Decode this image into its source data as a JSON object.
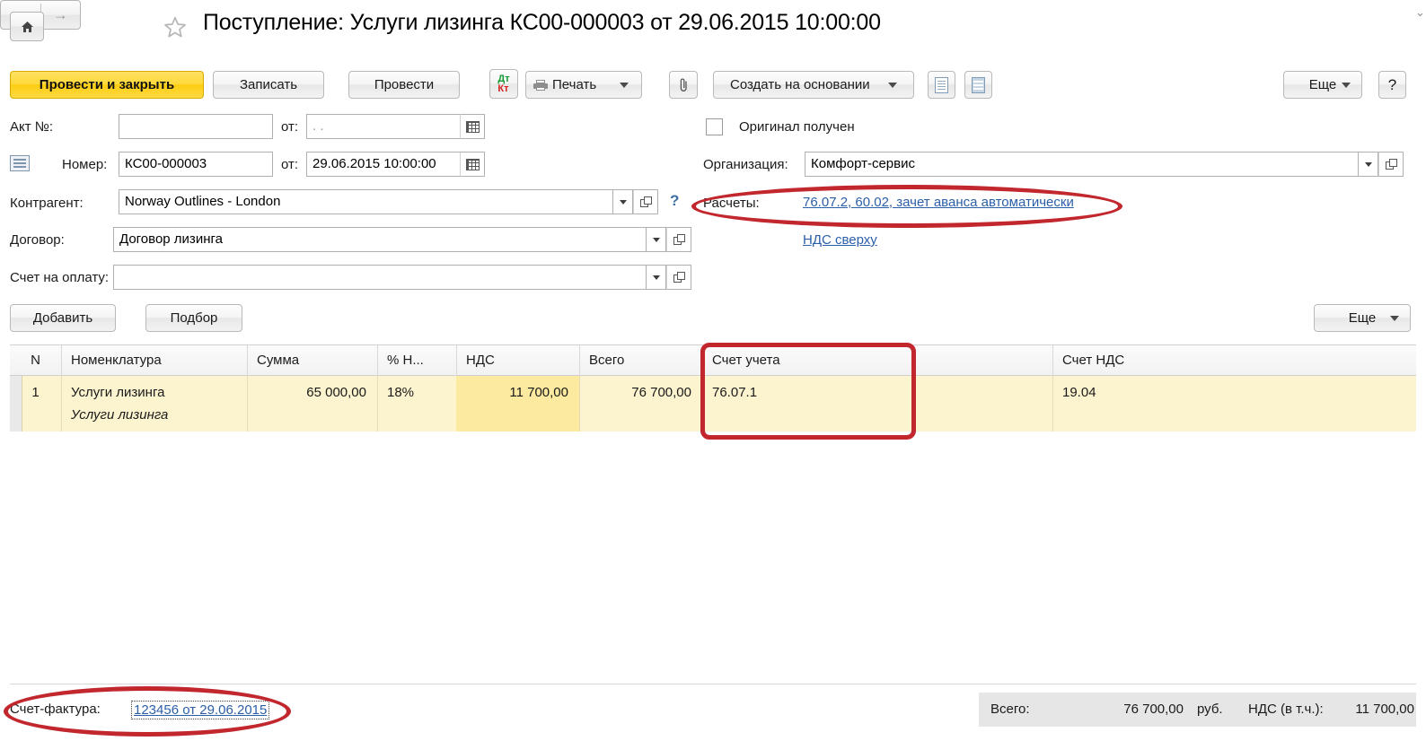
{
  "window": {
    "title": "Поступление: Услуги лизинга КС00-000003 от 29.06.2015 10:00:00"
  },
  "nav": {
    "home_icon": "home-icon",
    "back_icon": "arrow-left-icon",
    "forward_icon": "arrow-right-icon",
    "favorite_icon": "star-icon"
  },
  "toolbar": {
    "post_and_close": "Провести и закрыть",
    "write": "Записать",
    "post": "Провести",
    "dt_label": "Дт",
    "kt_label": "Кт",
    "print": "Печать",
    "attach_icon": "paperclip-icon",
    "create_based_on": "Создать на основании",
    "doc_icon": "document-icon",
    "register_icon": "register-list-icon",
    "more": "Еще",
    "help": "?"
  },
  "form": {
    "act_number_label": "Акт №:",
    "act_number_value": "",
    "act_from_label": "от:",
    "act_from_value": ". .",
    "number_label": "Номер:",
    "number_value": "КС00-000003",
    "number_from_label": "от:",
    "number_from_value": "29.06.2015 10:00:00",
    "counterparty_label": "Контрагент:",
    "counterparty_value": "Norway Outlines - London",
    "contract_label": "Договор:",
    "contract_value": "Договор лизинга",
    "invoice_for_payment_label": "Счет на оплату:",
    "invoice_for_payment_value": "",
    "original_received_label": "Оригинал получен",
    "organization_label": "Организация:",
    "organization_value": "Комфорт-сервис",
    "settlements_label": "Расчеты:",
    "settlements_link": "76.07.2, 60.02, зачет аванса автоматически",
    "vat_link": "НДС сверху",
    "note_icon": "note-icon",
    "calendar_icon": "calendar-icon",
    "select_icon": "open-picker-icon",
    "dropdown_icon": "chevron-down-icon",
    "help_icon": "question-icon"
  },
  "table_toolbar": {
    "add": "Добавить",
    "pick": "Подбор",
    "more": "Еще"
  },
  "grid": {
    "columns": [
      "N",
      "Номенклатура",
      "Сумма",
      "% Н...",
      "НДС",
      "Всего",
      "Счет учета",
      "",
      "Счет НДС"
    ],
    "rows": [
      {
        "n": "1",
        "nomenclature": "Услуги лизинга",
        "nomenclature_sub": "Услуги лизинга",
        "amount": "65 000,00",
        "vat_rate": "18%",
        "vat": "11 700,00",
        "total": "76 700,00",
        "account": "76.07.1",
        "vat_account": "19.04"
      }
    ]
  },
  "footer": {
    "invoice_label": "Счет-фактура:",
    "invoice_link": "123456 от 29.06.2015",
    "total_label": "Всего:",
    "total_value": "76 700,00",
    "currency": "руб.",
    "vat_label": "НДС (в т.ч.):",
    "vat_value": "11 700,00"
  },
  "colors": {
    "accent_yellow": "#ffd93a",
    "row_highlight": "#fcf3cf",
    "cell_highlight": "#fbeaa0",
    "link": "#2b5fa8",
    "annotation_red": "#c1272d"
  }
}
